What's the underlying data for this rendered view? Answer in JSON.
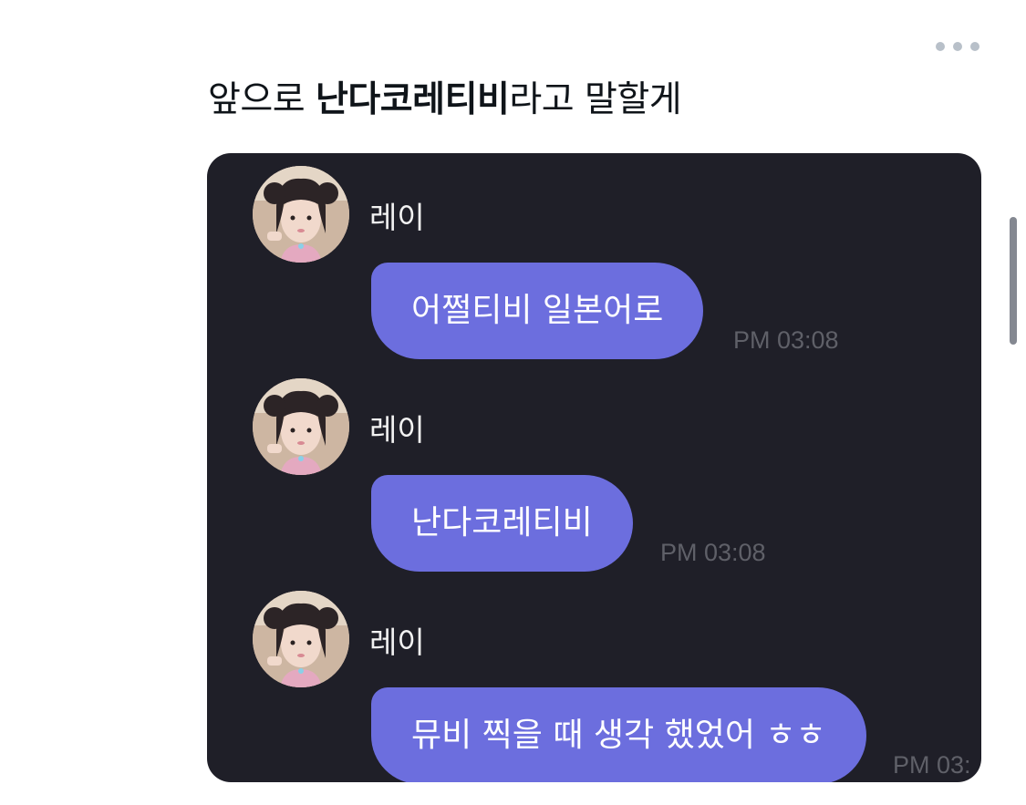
{
  "post": {
    "text_prefix": "앞으로 ",
    "text_bold": "난다코레티비",
    "text_suffix": "라고 말할게"
  },
  "more_icon": "more-horizontal-icon",
  "chat": {
    "messages": [
      {
        "sender": "레이",
        "text": "어쩔티비 일본어로",
        "time": "PM 03:08"
      },
      {
        "sender": "레이",
        "text": "난다코레티비",
        "time": "PM 03:08"
      },
      {
        "sender": "레이",
        "text": "뮤비 찍을 때 생각 했었어 ㅎㅎ",
        "time": "PM 03:"
      }
    ]
  },
  "colors": {
    "chat_background": "#1f1f28",
    "bubble": "#6c6ede",
    "time_text": "#5f6068",
    "more_dots": "#b8c0c9"
  }
}
